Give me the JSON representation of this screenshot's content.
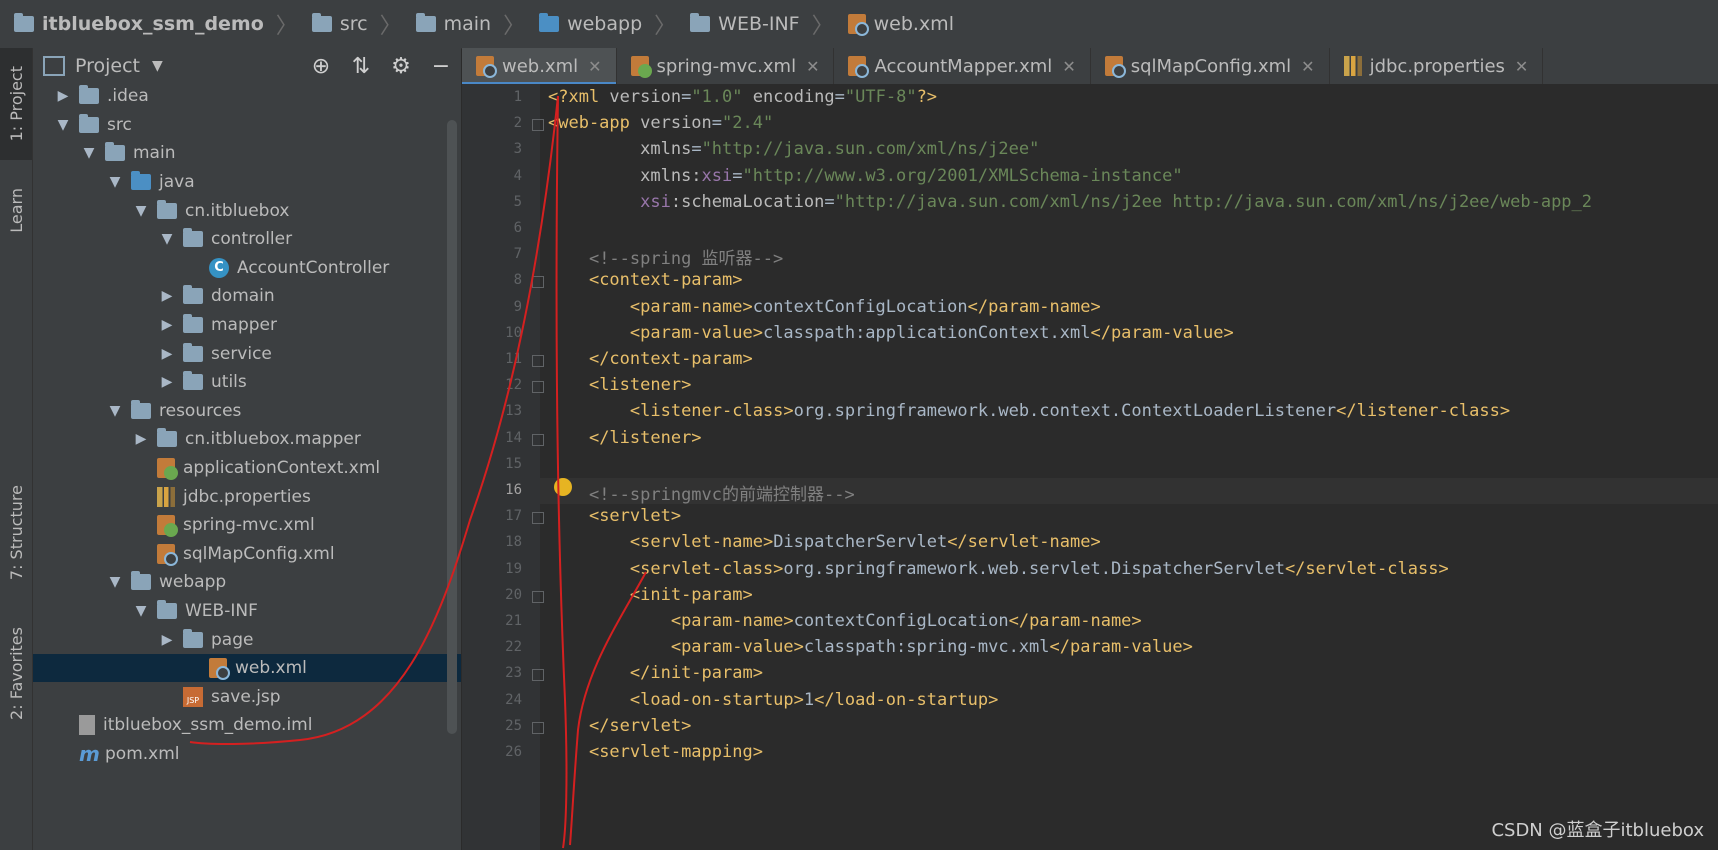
{
  "breadcrumb": [
    "itbluebox_ssm_demo",
    "src",
    "main",
    "webapp",
    "WEB-INF",
    "web.xml"
  ],
  "left_strip": {
    "project": "1: Project",
    "learn": "Learn",
    "structure": "7: Structure",
    "favorites": "2: Favorites"
  },
  "panel": {
    "title": "Project"
  },
  "tree": [
    {
      "label": ".idea",
      "depth": 1,
      "arrow": "right",
      "icon": "folder-icon"
    },
    {
      "label": "src",
      "depth": 1,
      "arrow": "down",
      "icon": "folder-icon"
    },
    {
      "label": "main",
      "depth": 2,
      "arrow": "down",
      "icon": "folder-icon"
    },
    {
      "label": "java",
      "depth": 3,
      "arrow": "down",
      "icon": "source-folder-icon"
    },
    {
      "label": "cn.itbluebox",
      "depth": 4,
      "arrow": "down",
      "icon": "package-icon"
    },
    {
      "label": "controller",
      "depth": 5,
      "arrow": "down",
      "icon": "package-icon"
    },
    {
      "label": "AccountController",
      "depth": 6,
      "arrow": "none",
      "icon": "class-icon"
    },
    {
      "label": "domain",
      "depth": 5,
      "arrow": "right",
      "icon": "package-icon"
    },
    {
      "label": "mapper",
      "depth": 5,
      "arrow": "right",
      "icon": "package-icon"
    },
    {
      "label": "service",
      "depth": 5,
      "arrow": "right",
      "icon": "package-icon"
    },
    {
      "label": "utils",
      "depth": 5,
      "arrow": "right",
      "icon": "package-icon"
    },
    {
      "label": "resources",
      "depth": 3,
      "arrow": "down",
      "icon": "resources-folder-icon"
    },
    {
      "label": "cn.itbluebox.mapper",
      "depth": 4,
      "arrow": "right",
      "icon": "folder-icon"
    },
    {
      "label": "applicationContext.xml",
      "depth": 4,
      "arrow": "none",
      "icon": "spring-xml-icon"
    },
    {
      "label": "jdbc.properties",
      "depth": 4,
      "arrow": "none",
      "icon": "properties-icon"
    },
    {
      "label": "spring-mvc.xml",
      "depth": 4,
      "arrow": "none",
      "icon": "spring-xml-icon"
    },
    {
      "label": "sqlMapConfig.xml",
      "depth": 4,
      "arrow": "none",
      "icon": "xml-icon"
    },
    {
      "label": "webapp",
      "depth": 3,
      "arrow": "down",
      "icon": "web-folder-icon"
    },
    {
      "label": "WEB-INF",
      "depth": 4,
      "arrow": "down",
      "icon": "folder-icon"
    },
    {
      "label": "page",
      "depth": 5,
      "arrow": "right",
      "icon": "folder-icon"
    },
    {
      "label": "web.xml",
      "depth": 6,
      "arrow": "none",
      "icon": "web-xml-icon",
      "selected": true
    },
    {
      "label": "save.jsp",
      "depth": 5,
      "arrow": "none",
      "icon": "jsp-icon"
    },
    {
      "label": "itbluebox_ssm_demo.iml",
      "depth": 1,
      "arrow": "none",
      "icon": "iml-icon"
    },
    {
      "label": "pom.xml",
      "depth": 1,
      "arrow": "none",
      "icon": "maven-icon"
    }
  ],
  "tabs": [
    {
      "label": "web.xml",
      "active": true,
      "icon": "web-xml-icon"
    },
    {
      "label": "spring-mvc.xml",
      "active": false,
      "icon": "spring-xml-icon"
    },
    {
      "label": "AccountMapper.xml",
      "active": false,
      "icon": "xml-icon"
    },
    {
      "label": "sqlMapConfig.xml",
      "active": false,
      "icon": "xml-icon"
    },
    {
      "label": "jdbc.properties",
      "active": false,
      "icon": "properties-icon"
    }
  ],
  "code_lines": [
    [
      [
        "dec",
        "<?xml "
      ],
      [
        "attr",
        "version"
      ],
      [
        "txt",
        "="
      ],
      [
        "val",
        "\"1.0\""
      ],
      [
        "txt",
        " "
      ],
      [
        "attr",
        "encoding"
      ],
      [
        "txt",
        "="
      ],
      [
        "val",
        "\"UTF-8\""
      ],
      [
        "dec",
        "?>"
      ]
    ],
    [
      [
        "tag",
        "<web-app "
      ],
      [
        "attr",
        "version"
      ],
      [
        "txt",
        "="
      ],
      [
        "val",
        "\"2.4\""
      ]
    ],
    [
      [
        "txt",
        "         "
      ],
      [
        "attr",
        "xmlns"
      ],
      [
        "txt",
        "="
      ],
      [
        "val",
        "\"http://java.sun.com/xml/ns/j2ee\""
      ]
    ],
    [
      [
        "txt",
        "         "
      ],
      [
        "attr",
        "xmlns:"
      ],
      [
        "ns",
        "xsi"
      ],
      [
        "txt",
        "="
      ],
      [
        "val",
        "\"http://www.w3.org/2001/XMLSchema-instance\""
      ]
    ],
    [
      [
        "txt",
        "         "
      ],
      [
        "ns",
        "xsi"
      ],
      [
        "attr",
        ":schemaLocation"
      ],
      [
        "txt",
        "="
      ],
      [
        "val",
        "\"http://java.sun.com/xml/ns/j2ee http://java.sun.com/xml/ns/j2ee/web-app_2"
      ]
    ],
    [
      [
        "txt",
        ""
      ]
    ],
    [
      [
        "txt",
        "    "
      ],
      [
        "com",
        "<!--spring 监听器-->"
      ]
    ],
    [
      [
        "txt",
        "    "
      ],
      [
        "tag",
        "<context-param>"
      ]
    ],
    [
      [
        "txt",
        "        "
      ],
      [
        "tag",
        "<param-name>"
      ],
      [
        "txt",
        "contextConfigLocation"
      ],
      [
        "tag",
        "</param-name>"
      ]
    ],
    [
      [
        "txt",
        "        "
      ],
      [
        "tag",
        "<param-value>"
      ],
      [
        "txt",
        "classpath:applicationContext.xml"
      ],
      [
        "tag",
        "</param-value>"
      ]
    ],
    [
      [
        "txt",
        "    "
      ],
      [
        "tag",
        "</context-param>"
      ]
    ],
    [
      [
        "txt",
        "    "
      ],
      [
        "tag",
        "<listener>"
      ]
    ],
    [
      [
        "txt",
        "        "
      ],
      [
        "tag",
        "<listener-class>"
      ],
      [
        "txt",
        "org.springframework.web.context.ContextLoaderListener"
      ],
      [
        "tag",
        "</listener-class>"
      ]
    ],
    [
      [
        "txt",
        "    "
      ],
      [
        "tag",
        "</listener>"
      ]
    ],
    [
      [
        "txt",
        ""
      ]
    ],
    [
      [
        "txt",
        "    "
      ],
      [
        "com",
        "<!--springmvc的前端控制器-->"
      ]
    ],
    [
      [
        "txt",
        "    "
      ],
      [
        "tag",
        "<servlet>"
      ]
    ],
    [
      [
        "txt",
        "        "
      ],
      [
        "tag",
        "<servlet-name>"
      ],
      [
        "txt",
        "DispatcherServlet"
      ],
      [
        "tag",
        "</servlet-name>"
      ]
    ],
    [
      [
        "txt",
        "        "
      ],
      [
        "tag",
        "<servlet-class>"
      ],
      [
        "txt",
        "org.springframework.web.servlet.DispatcherServlet"
      ],
      [
        "tag",
        "</servlet-class>"
      ]
    ],
    [
      [
        "txt",
        "        "
      ],
      [
        "tag",
        "<init-param>"
      ]
    ],
    [
      [
        "txt",
        "            "
      ],
      [
        "tag",
        "<param-name>"
      ],
      [
        "txt",
        "contextConfigLocation"
      ],
      [
        "tag",
        "</param-name>"
      ]
    ],
    [
      [
        "txt",
        "            "
      ],
      [
        "tag",
        "<param-value>"
      ],
      [
        "txt",
        "classpath:spring-mvc.xml"
      ],
      [
        "tag",
        "</param-value>"
      ]
    ],
    [
      [
        "txt",
        "        "
      ],
      [
        "tag",
        "</init-param>"
      ]
    ],
    [
      [
        "txt",
        "        "
      ],
      [
        "tag",
        "<load-on-startup>"
      ],
      [
        "txt",
        "1"
      ],
      [
        "tag",
        "</load-on-startup>"
      ]
    ],
    [
      [
        "txt",
        "    "
      ],
      [
        "tag",
        "</servlet>"
      ]
    ],
    [
      [
        "txt",
        "    "
      ],
      [
        "tag",
        "<servlet-mapping>"
      ]
    ]
  ],
  "current_line": 16,
  "watermark": "CSDN @蓝盒子itbluebox",
  "colors": {
    "tag": "#e8bf6a",
    "attr": "#bababa",
    "value": "#6a8759",
    "comment": "#808080",
    "selection": "#0d293e",
    "annotation": "#d42020"
  }
}
